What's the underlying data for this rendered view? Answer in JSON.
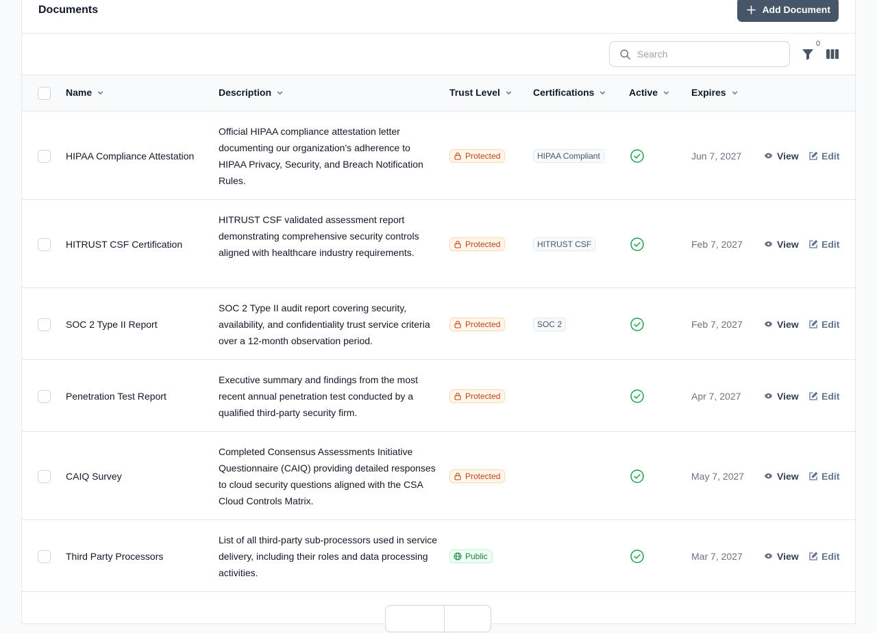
{
  "header": {
    "title": "Documents",
    "add_label": "Add Document"
  },
  "toolbar": {
    "search_placeholder": "Search",
    "filter_count": "0"
  },
  "columns": {
    "name": "Name",
    "description": "Description",
    "trust": "Trust Level",
    "certifications": "Certifications",
    "active": "Active",
    "expires": "Expires"
  },
  "row_actions": {
    "view": "View",
    "edit": "Edit"
  },
  "rows": [
    {
      "name": "HIPAA Compliance Attestation",
      "description": "Official HIPAA compliance attestation letter documenting our organization's adherence to HIPAA Privacy, Security, and Breach Notification Rules.",
      "trust": "Protected",
      "certification": "HIPAA Compliant",
      "expires": "Jun 7, 2027"
    },
    {
      "name": "HITRUST CSF Certification",
      "description": "HITRUST CSF validated assessment report demonstrating comprehensive security controls aligned with healthcare industry requirements.",
      "trust": "Protected",
      "certification": "HITRUST CSF",
      "expires": "Feb 7, 2027"
    },
    {
      "name": "SOC 2 Type II Report",
      "description": "SOC 2 Type II audit report covering security, availability, and confidentiality trust service criteria over a 12-month observation period.",
      "trust": "Protected",
      "certification": "SOC 2",
      "expires": "Feb 7, 2027"
    },
    {
      "name": "Penetration Test Report",
      "description": "Executive summary and findings from the most recent annual penetration test conducted by a qualified third-party security firm.",
      "trust": "Protected",
      "certification": "",
      "expires": "Apr 7, 2027"
    },
    {
      "name": "CAIQ Survey",
      "description": "Completed Consensus Assessments Initiative Questionnaire (CAIQ) providing detailed responses to cloud security questions aligned with the CSA Cloud Controls Matrix.",
      "trust": "Protected",
      "certification": "",
      "expires": "May 7, 2027"
    },
    {
      "name": "Third Party Processors",
      "description": "List of all third-party sub-processors used in service delivery, including their roles and data processing activities.",
      "trust": "Public",
      "certification": "",
      "expires": "Mar 7, 2027"
    }
  ],
  "colors": {
    "primary_button": "#475569",
    "protected_text": "#c2410c",
    "public_text": "#15803d",
    "active_check": "#16a34a"
  }
}
